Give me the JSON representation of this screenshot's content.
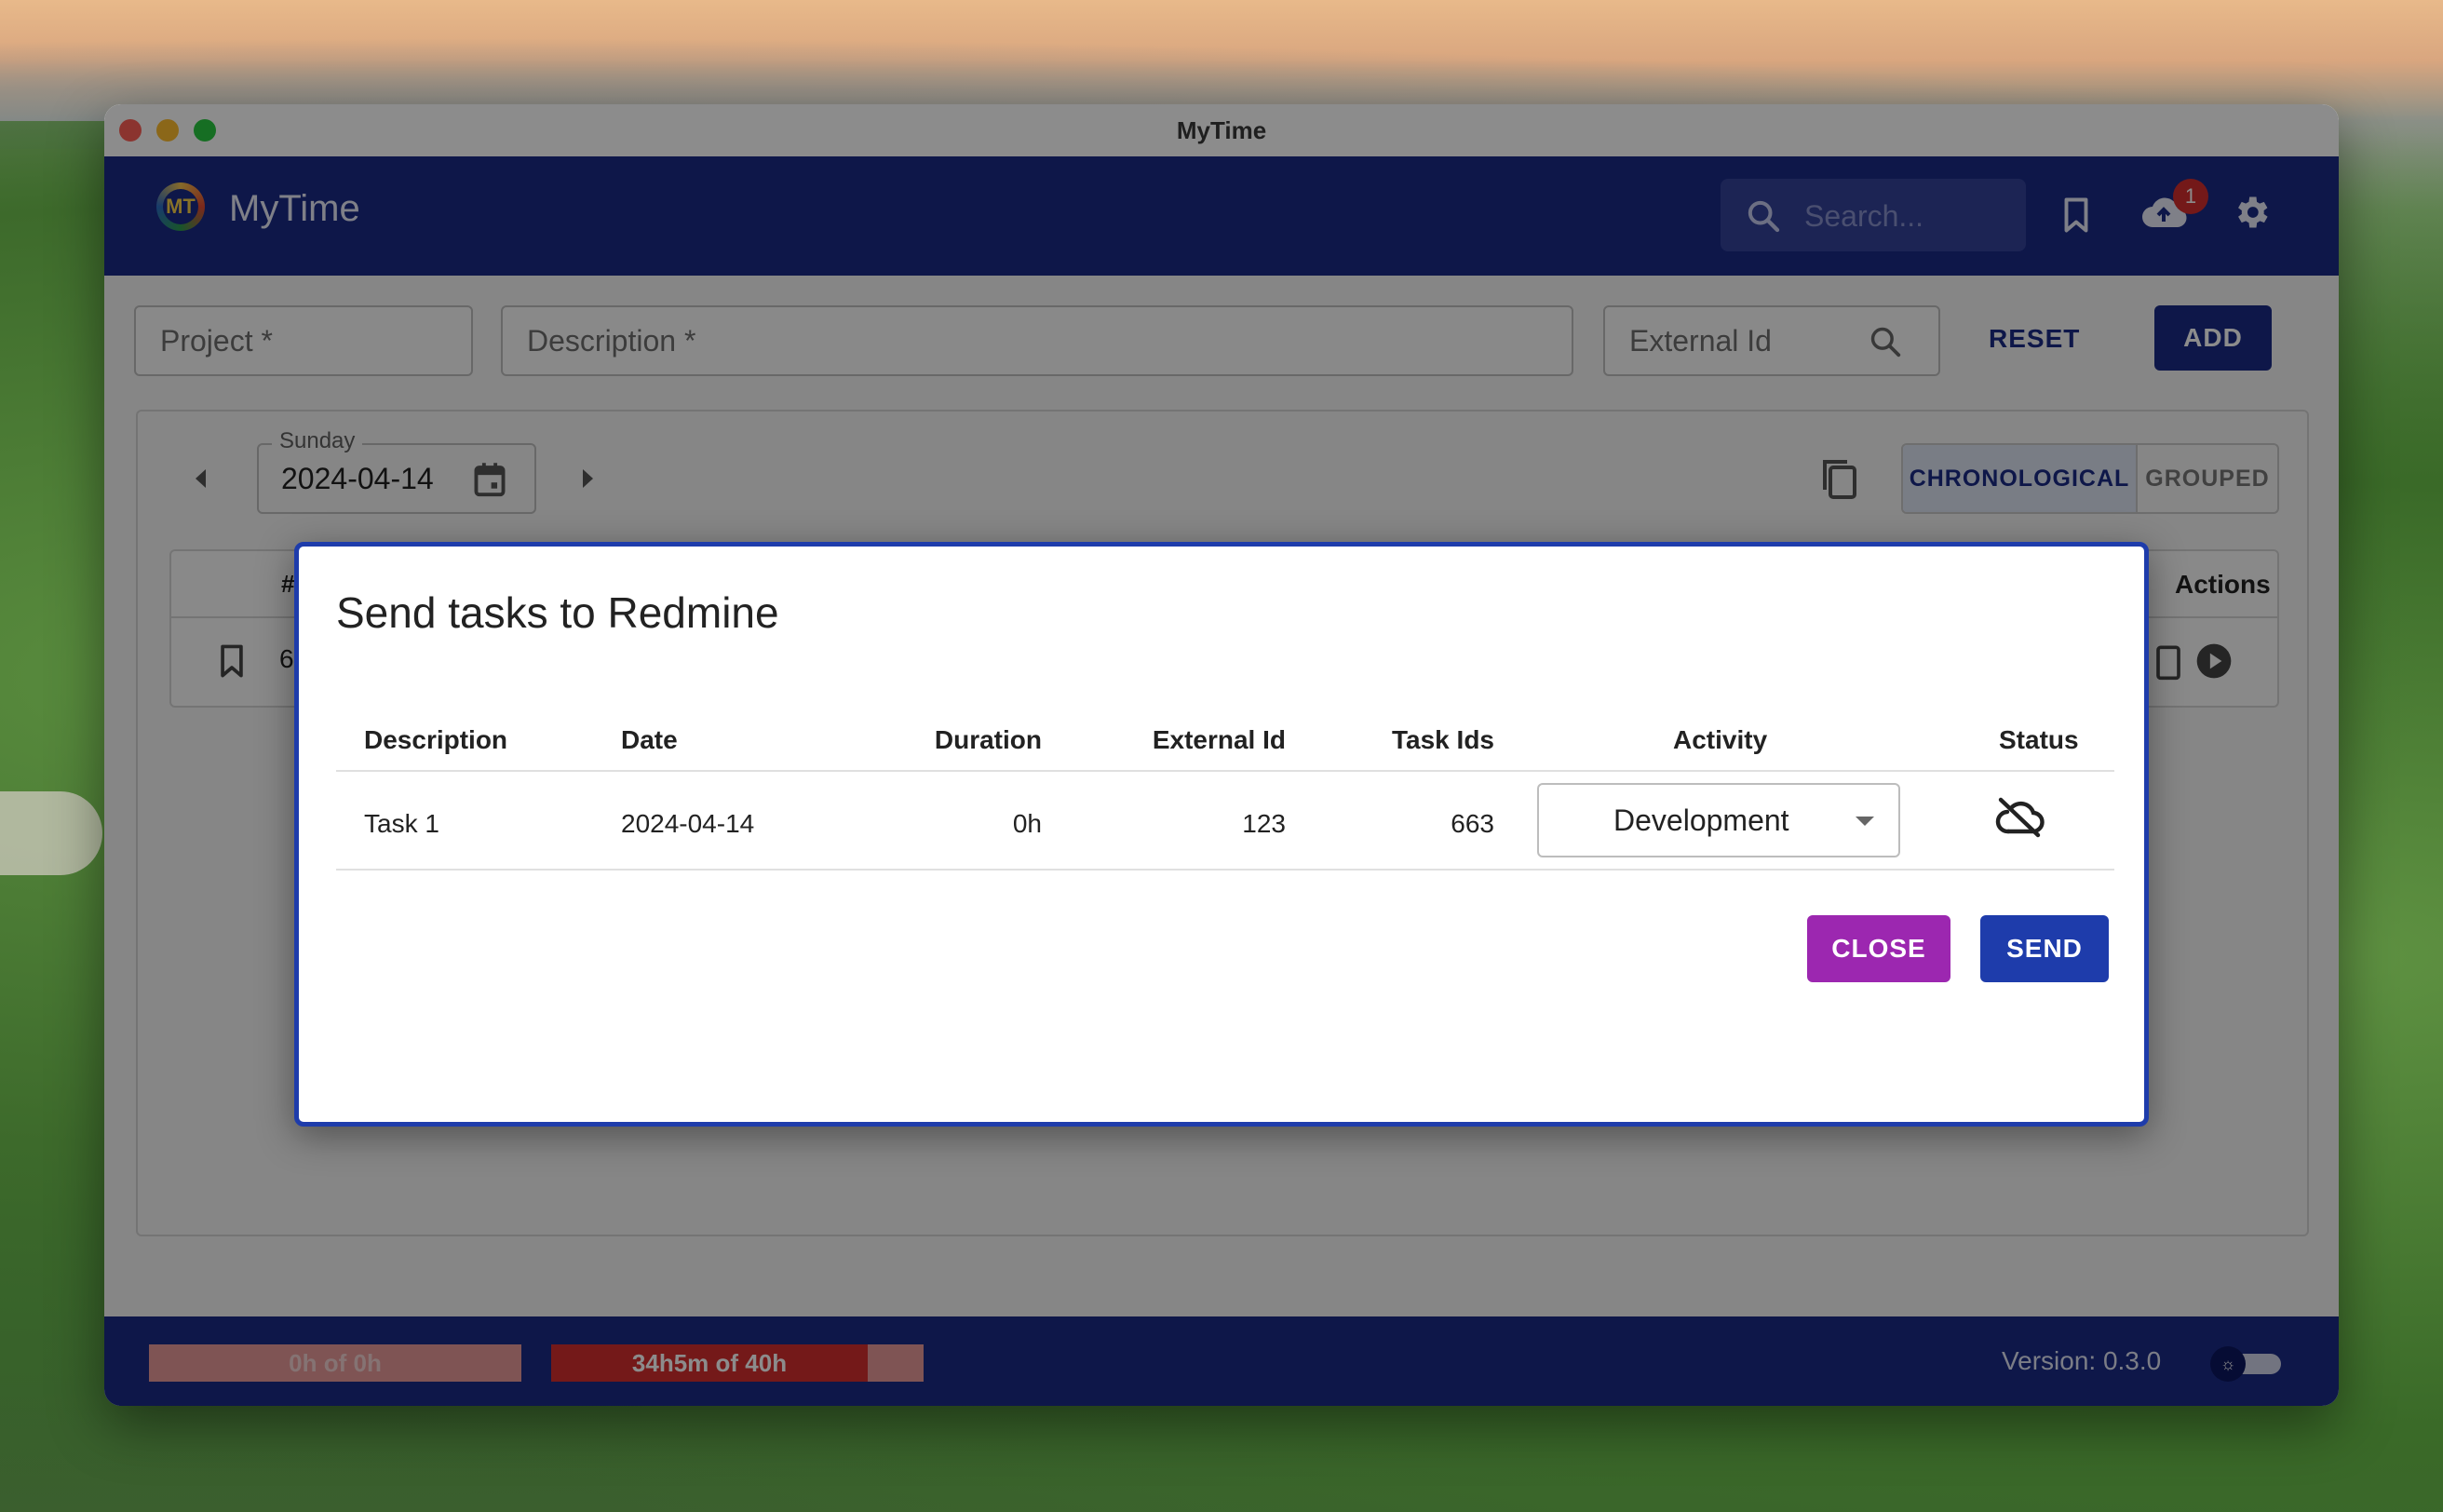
{
  "window": {
    "title": "MyTime"
  },
  "appbar": {
    "app_name": "MyTime",
    "logo_letters": "MT",
    "search_placeholder": "Search...",
    "upload_badge": "1"
  },
  "form": {
    "project_placeholder": "Project *",
    "description_placeholder": "Description *",
    "external_id_placeholder": "External Id",
    "reset_label": "RESET",
    "add_label": "ADD"
  },
  "day_view": {
    "day_label": "Sunday",
    "date": "2024-04-14",
    "view_chronological": "CHRONOLOGICAL",
    "view_grouped": "GROUPED",
    "table_header_hash": "#",
    "table_header_actions": "Actions",
    "row_id_partial": "6"
  },
  "footer": {
    "progress_day_label": "0h of 0h",
    "progress_day_fraction": 0,
    "progress_week_label": "34h5m of 40h",
    "progress_week_fraction": 0.85,
    "version": "Version: 0.3.0",
    "theme_icon": "☼"
  },
  "dialog": {
    "title": "Send tasks to Redmine",
    "columns": {
      "description": "Description",
      "date": "Date",
      "duration": "Duration",
      "external_id": "External Id",
      "task_ids": "Task Ids",
      "activity": "Activity",
      "status": "Status"
    },
    "rows": [
      {
        "description": "Task 1",
        "date": "2024-04-14",
        "duration": "0h",
        "external_id": "123",
        "task_ids": "663",
        "activity": "Development",
        "status_icon": "cloud-off-icon"
      }
    ],
    "close_label": "CLOSE",
    "send_label": "SEND"
  },
  "colors": {
    "primary": "#1a2a86",
    "accent_purple": "#9c27b0",
    "progress_red": "#d32f2f"
  }
}
